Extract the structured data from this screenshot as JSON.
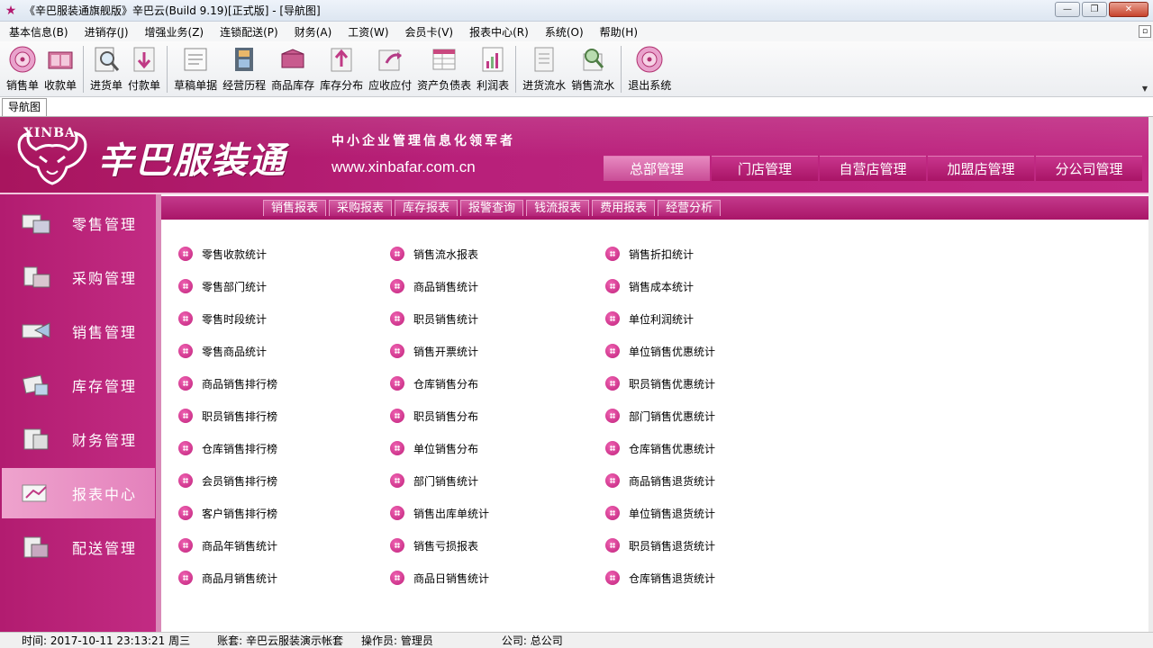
{
  "window": {
    "title": "《辛巴服装通旗舰版》辛巴云(Build 9.19)[正式版] - [导航图]"
  },
  "menu": [
    "基本信息(B)",
    "进销存(J)",
    "增强业务(Z)",
    "连锁配送(P)",
    "财务(A)",
    "工资(W)",
    "会员卡(V)",
    "报表中心(R)",
    "系统(O)",
    "帮助(H)"
  ],
  "toolbar": [
    {
      "label": "销售单",
      "icon": "sales-disc-icon"
    },
    {
      "label": "收款单",
      "icon": "receipt-book-icon"
    },
    {
      "label": "进货单",
      "icon": "purchase-search-icon"
    },
    {
      "label": "付款单",
      "icon": "payment-arrow-icon"
    },
    {
      "label": "草稿单据",
      "icon": "draft-form-icon"
    },
    {
      "label": "经营历程",
      "icon": "film-history-icon"
    },
    {
      "label": "商品库存",
      "icon": "inventory-box-icon"
    },
    {
      "label": "库存分布",
      "icon": "stock-up-arrow-icon"
    },
    {
      "label": "应收应付",
      "icon": "receivable-payable-icon"
    },
    {
      "label": "资产负债表",
      "icon": "balance-sheet-icon"
    },
    {
      "label": "利润表",
      "icon": "profit-chart-icon"
    },
    {
      "label": "进货流水",
      "icon": "purchase-log-icon"
    },
    {
      "label": "销售流水",
      "icon": "sales-log-icon"
    },
    {
      "label": "退出系统",
      "icon": "exit-disc-icon"
    }
  ],
  "navtab": {
    "label": "导航图"
  },
  "banner": {
    "brand_en": "XINBA",
    "brand_cn": "辛巴服装通",
    "slogan": "中小企业管理信息化领军者",
    "website": "www.xinbafar.com.cn",
    "top_tabs": [
      "总部管理",
      "门店管理",
      "自营店管理",
      "加盟店管理",
      "分公司管理"
    ],
    "active_top_tab": "总部管理"
  },
  "leftnav": {
    "items": [
      "零售管理",
      "采购管理",
      "销售管理",
      "库存管理",
      "财务管理",
      "报表中心",
      "配送管理"
    ],
    "active": "报表中心"
  },
  "subtabs": [
    "销售报表",
    "采购报表",
    "库存报表",
    "报警查询",
    "钱流报表",
    "费用报表",
    "经营分析"
  ],
  "reports": {
    "col1": [
      "零售收款统计",
      "零售部门统计",
      "零售时段统计",
      "零售商品统计",
      "商品销售排行榜",
      "职员销售排行榜",
      "仓库销售排行榜",
      "会员销售排行榜",
      "客户销售排行榜",
      "商品年销售统计",
      "商品月销售统计"
    ],
    "col2": [
      "销售流水报表",
      "商品销售统计",
      "职员销售统计",
      "销售开票统计",
      "仓库销售分布",
      "职员销售分布",
      "单位销售分布",
      "部门销售统计",
      "销售出库单统计",
      "销售亏损报表",
      "商品日销售统计"
    ],
    "col3": [
      "销售折扣统计",
      "销售成本统计",
      "单位利润统计",
      "单位销售优惠统计",
      "职员销售优惠统计",
      "部门销售优惠统计",
      "仓库销售优惠统计",
      "商品销售退货统计",
      "单位销售退货统计",
      "职员销售退货统计",
      "仓库销售退货统计"
    ]
  },
  "status": {
    "time": "时间: 2017-10-11 23:13:21 周三",
    "account": "账套: 辛巴云服装演示帐套",
    "operator": "操作员: 管理员",
    "company": "公司: 总公司"
  },
  "colors": {
    "brand": "#b8207a",
    "active_nav": "#e481bc"
  }
}
